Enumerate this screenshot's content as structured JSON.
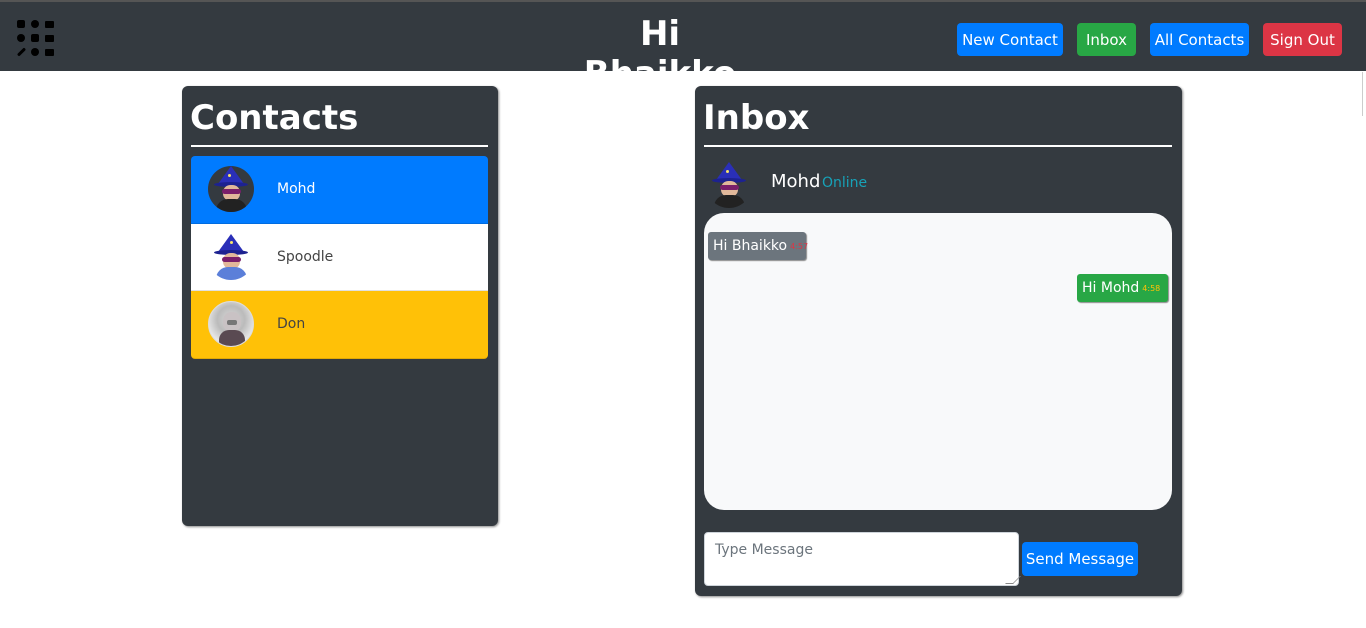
{
  "navbar": {
    "logo_icon": "contact-icons-grid-icon",
    "greeting": "Hi Bhaikko",
    "buttons": {
      "new_contact": "New Contact",
      "inbox": "Inbox",
      "all_contacts": "All Contacts",
      "sign_out": "Sign Out"
    },
    "colors": {
      "background": "#343a40",
      "primary": "#007bff",
      "success": "#28a745",
      "danger": "#dc3545"
    }
  },
  "contacts": {
    "title": "Contacts",
    "items": [
      {
        "name": "Mohd",
        "avatar": "wizard-avatar-icon",
        "state": "active",
        "color": "#007bff"
      },
      {
        "name": "Spoodle",
        "avatar": "wizard-avatar-icon",
        "state": "default",
        "color": "#ffffff"
      },
      {
        "name": "Don",
        "avatar": "photo-avatar-icon",
        "state": "warning",
        "color": "#ffc107"
      }
    ]
  },
  "inbox": {
    "title": "Inbox",
    "contact": {
      "name": "Mohd",
      "status": "Online",
      "status_color": "#17a2b8"
    },
    "messages": [
      {
        "direction": "incoming",
        "text": "Hi Bhaikko",
        "time": "4:57",
        "color": "#6c757d"
      },
      {
        "direction": "outgoing",
        "text": "Hi Mohd",
        "time": "4:58",
        "color": "#28a745"
      }
    ],
    "composer": {
      "placeholder": "Type Message",
      "value": "",
      "send_label": "Send Message"
    }
  }
}
